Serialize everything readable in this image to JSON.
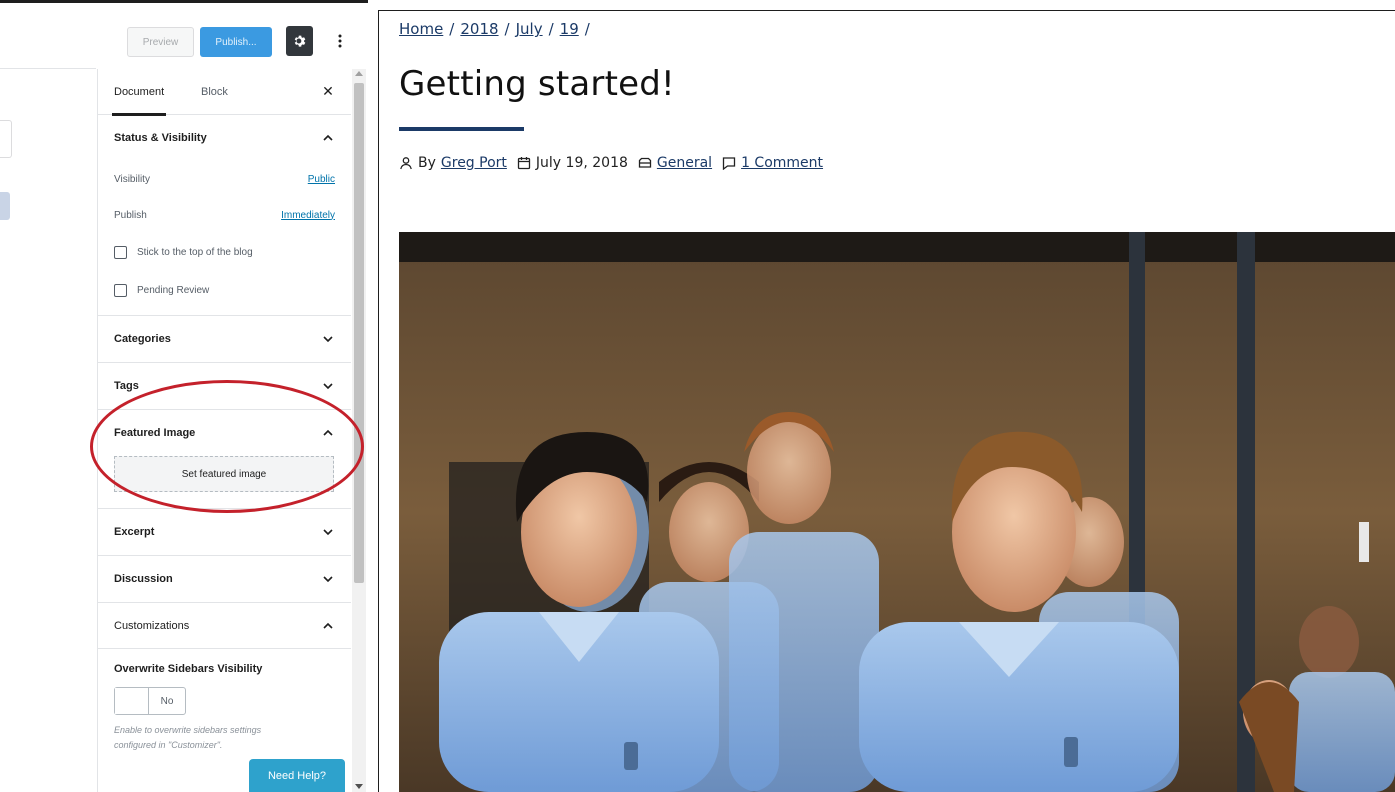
{
  "editor": {
    "header": {
      "preview_label": "Preview",
      "publish_label": "Publish...",
      "settings_icon": "gear-icon",
      "more_icon": "kebab-menu-icon"
    },
    "sidebar": {
      "tabs": {
        "document": "Document",
        "block": "Block"
      },
      "close_icon": "close-icon",
      "status": {
        "title": "Status & Visibility",
        "visibility_label": "Visibility",
        "visibility_value": "Public",
        "publish_label": "Publish",
        "publish_value": "Immediately",
        "sticky_label": "Stick to the top of the blog",
        "pending_label": "Pending Review"
      },
      "panels": {
        "categories": "Categories",
        "tags": "Tags",
        "featured_image": "Featured Image",
        "set_featured_image": "Set featured image",
        "excerpt": "Excerpt",
        "discussion": "Discussion",
        "customizations": "Customizations"
      },
      "customizations": {
        "overwrite_title": "Overwrite Sidebars Visibility",
        "toggle_value": "No",
        "description": "Enable to overwrite sidebars settings configured in \"Customizer\"."
      }
    },
    "need_help": "Need Help?"
  },
  "frontend": {
    "breadcrumbs": [
      "Home",
      "2018",
      "July",
      "19"
    ],
    "breadcrumb_separator": "/",
    "title": "Getting started!",
    "meta": {
      "by": "By",
      "author": "Greg Port",
      "date": "July 19, 2018",
      "category": "General",
      "comments": "1 Comment"
    }
  },
  "colors": {
    "wp_blue": "#0073aa",
    "publish_blue": "#3b9ae1",
    "need_help_blue": "#2ea2cc",
    "highlight_red": "#c4212b",
    "site_navy": "#1b3a67"
  }
}
